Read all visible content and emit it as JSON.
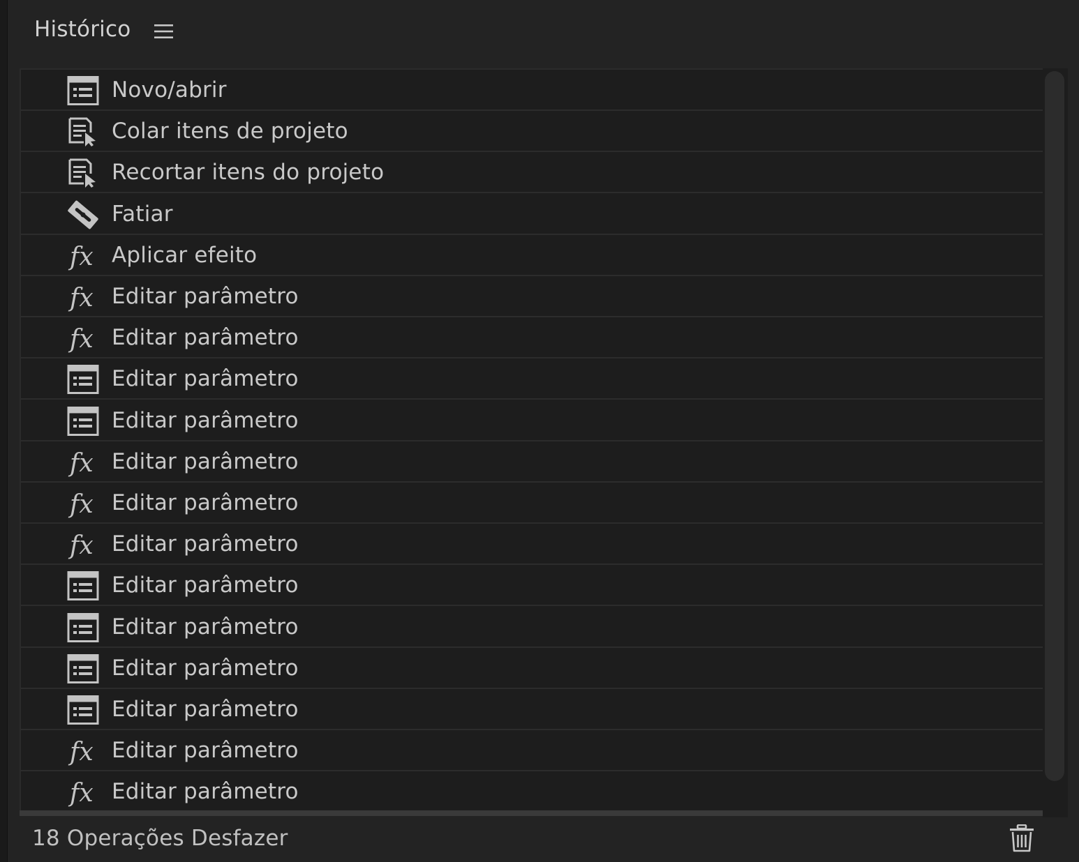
{
  "panel": {
    "title": "Histórico",
    "menu_icon": "hamburger-menu-icon"
  },
  "history": {
    "items": [
      {
        "icon": "document-list-icon",
        "label": "Novo/abrir"
      },
      {
        "icon": "paste-document-icon",
        "label": "Colar itens de projeto"
      },
      {
        "icon": "paste-document-icon",
        "label": "Recortar itens do projeto"
      },
      {
        "icon": "razor-blade-icon",
        "label": "Fatiar"
      },
      {
        "icon": "fx-icon",
        "label": "Aplicar efeito"
      },
      {
        "icon": "fx-icon",
        "label": "Editar parâmetro"
      },
      {
        "icon": "fx-icon",
        "label": "Editar parâmetro"
      },
      {
        "icon": "document-list-icon",
        "label": "Editar parâmetro"
      },
      {
        "icon": "document-list-icon",
        "label": "Editar parâmetro"
      },
      {
        "icon": "fx-icon",
        "label": "Editar parâmetro"
      },
      {
        "icon": "fx-icon",
        "label": "Editar parâmetro"
      },
      {
        "icon": "fx-icon",
        "label": "Editar parâmetro"
      },
      {
        "icon": "document-list-icon",
        "label": "Editar parâmetro"
      },
      {
        "icon": "document-list-icon",
        "label": "Editar parâmetro"
      },
      {
        "icon": "document-list-icon",
        "label": "Editar parâmetro"
      },
      {
        "icon": "document-list-icon",
        "label": "Editar parâmetro"
      },
      {
        "icon": "fx-icon",
        "label": "Editar parâmetro"
      },
      {
        "icon": "fx-icon",
        "label": "Editar parâmetro"
      }
    ]
  },
  "footer": {
    "status": "18 Operações Desfazer",
    "delete_icon": "trash-icon"
  },
  "colors": {
    "panel_bg": "#232323",
    "list_bg": "#1d1d1d",
    "text": "#c9c9c9",
    "divider": "#2c2c2c"
  }
}
